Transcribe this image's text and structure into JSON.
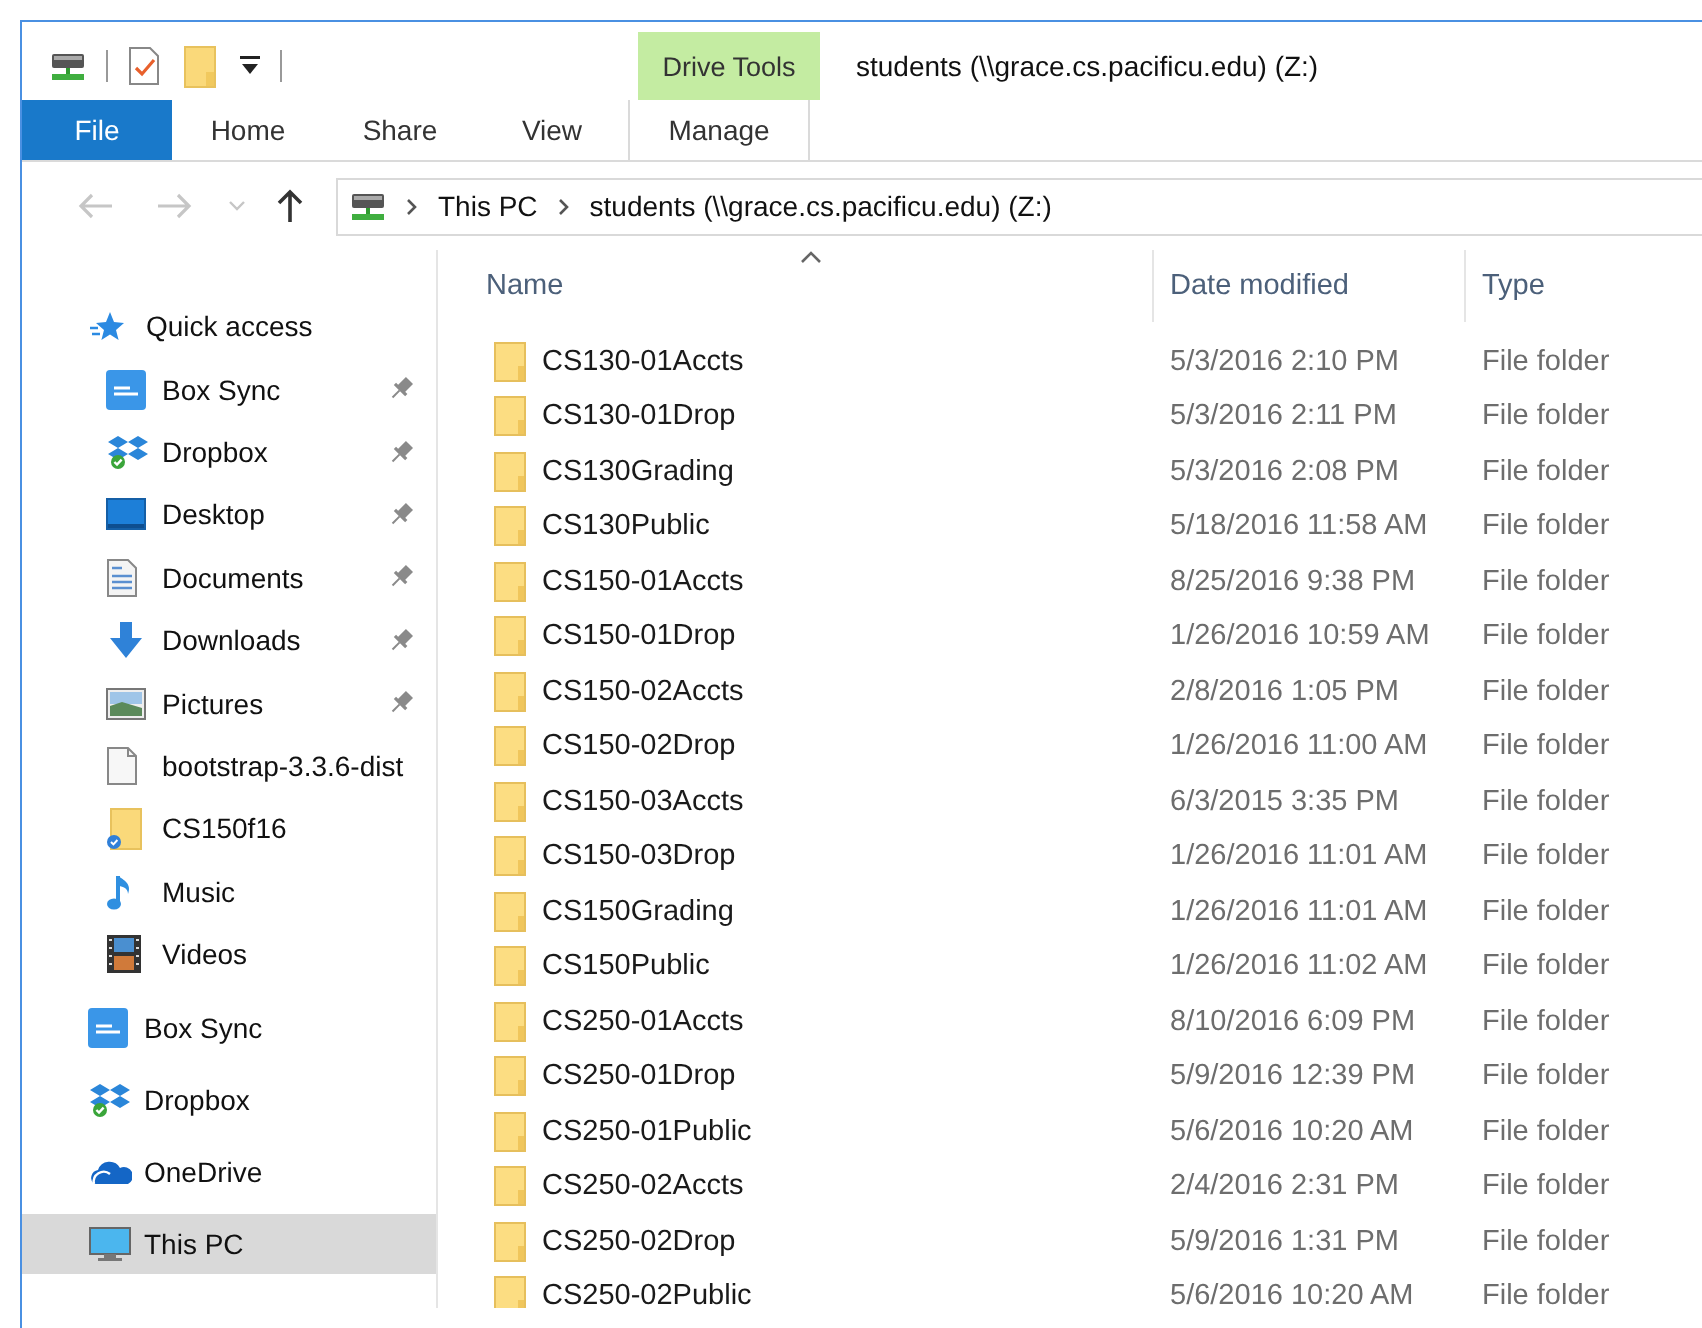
{
  "window": {
    "title": "students (\\\\grace.cs.pacificu.edu) (Z:)"
  },
  "ribbon": {
    "context_group": "Drive Tools",
    "tabs": [
      {
        "label": "File",
        "kind": "file"
      },
      {
        "label": "Home",
        "kind": "tab"
      },
      {
        "label": "Share",
        "kind": "tab"
      },
      {
        "label": "View",
        "kind": "tab"
      },
      {
        "label": "Manage",
        "kind": "context"
      }
    ]
  },
  "navigation_buttons": [
    {
      "kind": "back",
      "disabled": true
    },
    {
      "kind": "forward",
      "disabled": true
    },
    {
      "kind": "recent",
      "disabled": true
    },
    {
      "kind": "up",
      "disabled": false
    }
  ],
  "address_bar": {
    "path": [
      "This PC",
      "students (\\\\grace.cs.pacificu.edu) (Z:)"
    ]
  },
  "navigation_pane": {
    "items": [
      {
        "label": "Quick access",
        "selected": false,
        "children": [
          {
            "label": "Box Sync",
            "pinned": true,
            "selected": false
          },
          {
            "label": "Dropbox",
            "pinned": true,
            "selected": false
          },
          {
            "label": "Desktop",
            "pinned": true,
            "selected": false
          },
          {
            "label": "Documents",
            "pinned": true,
            "selected": false
          },
          {
            "label": "Downloads",
            "pinned": true,
            "selected": false
          },
          {
            "label": "Pictures",
            "pinned": true,
            "selected": false
          },
          {
            "label": "bootstrap-3.3.6-dist",
            "pinned": false,
            "selected": false
          },
          {
            "label": "CS150f16",
            "pinned": false,
            "selected": false
          },
          {
            "label": "Music",
            "pinned": false,
            "selected": false
          },
          {
            "label": "Videos",
            "pinned": false,
            "selected": false
          }
        ]
      },
      {
        "label": "Box Sync",
        "selected": false
      },
      {
        "label": "Dropbox",
        "selected": false
      },
      {
        "label": "OneDrive",
        "selected": false
      },
      {
        "label": "This PC",
        "selected": true
      }
    ]
  },
  "table": {
    "columns": [
      {
        "label": "Name",
        "sorted": true
      },
      {
        "label": "Date modified",
        "sorted": false
      },
      {
        "label": "Type",
        "sorted": false
      }
    ],
    "rows": [
      {
        "name": "CS130-01Accts",
        "date_modified": "5/3/2016 2:10 PM",
        "type": "File folder"
      },
      {
        "name": "CS130-01Drop",
        "date_modified": "5/3/2016 2:11 PM",
        "type": "File folder"
      },
      {
        "name": "CS130Grading",
        "date_modified": "5/3/2016 2:08 PM",
        "type": "File folder"
      },
      {
        "name": "CS130Public",
        "date_modified": "5/18/2016 11:58 AM",
        "type": "File folder"
      },
      {
        "name": "CS150-01Accts",
        "date_modified": "8/25/2016 9:38 PM",
        "type": "File folder"
      },
      {
        "name": "CS150-01Drop",
        "date_modified": "1/26/2016 10:59 AM",
        "type": "File folder"
      },
      {
        "name": "CS150-02Accts",
        "date_modified": "2/8/2016 1:05 PM",
        "type": "File folder"
      },
      {
        "name": "CS150-02Drop",
        "date_modified": "1/26/2016 11:00 AM",
        "type": "File folder"
      },
      {
        "name": "CS150-03Accts",
        "date_modified": "6/3/2015 3:35 PM",
        "type": "File folder"
      },
      {
        "name": "CS150-03Drop",
        "date_modified": "1/26/2016 11:01 AM",
        "type": "File folder"
      },
      {
        "name": "CS150Grading",
        "date_modified": "1/26/2016 11:01 AM",
        "type": "File folder"
      },
      {
        "name": "CS150Public",
        "date_modified": "1/26/2016 11:02 AM",
        "type": "File folder"
      },
      {
        "name": "CS250-01Accts",
        "date_modified": "8/10/2016 6:09 PM",
        "type": "File folder"
      },
      {
        "name": "CS250-01Drop",
        "date_modified": "5/9/2016 12:39 PM",
        "type": "File folder"
      },
      {
        "name": "CS250-01Public",
        "date_modified": "5/6/2016 10:20 AM",
        "type": "File folder"
      },
      {
        "name": "CS250-02Accts",
        "date_modified": "2/4/2016 2:31 PM",
        "type": "File folder"
      },
      {
        "name": "CS250-02Drop",
        "date_modified": "5/9/2016 1:31 PM",
        "type": "File folder"
      },
      {
        "name": "CS250-02Public",
        "date_modified": "5/6/2016 10:20 AM",
        "type": "File folder"
      }
    ]
  }
}
